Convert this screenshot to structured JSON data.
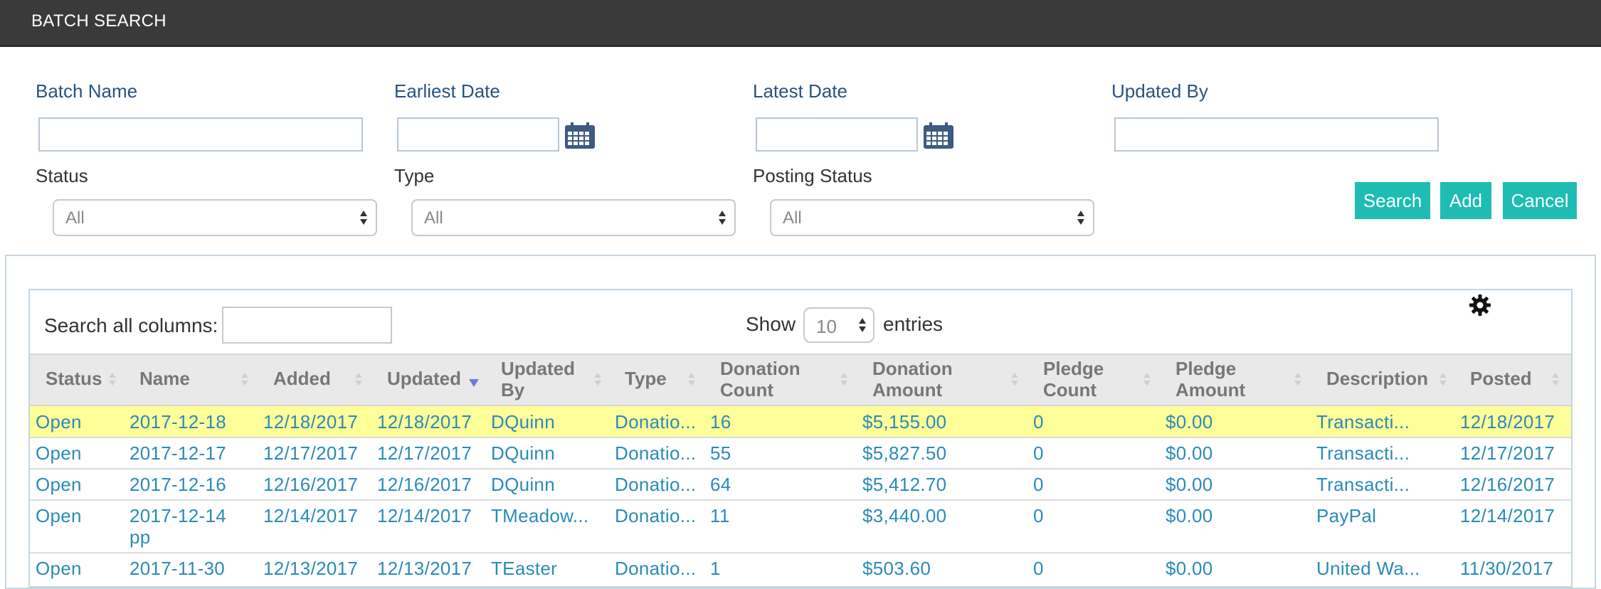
{
  "header": {
    "title": "BATCH SEARCH"
  },
  "filters": {
    "batch_name": {
      "label": "Batch Name",
      "value": ""
    },
    "earliest_date": {
      "label": "Earliest Date",
      "value": ""
    },
    "latest_date": {
      "label": "Latest Date",
      "value": ""
    },
    "updated_by": {
      "label": "Updated By",
      "value": ""
    },
    "status": {
      "label": "Status",
      "selected": "All"
    },
    "type": {
      "label": "Type",
      "selected": "All"
    },
    "posting_status": {
      "label": "Posting Status",
      "selected": "All"
    }
  },
  "actions": {
    "search": "Search",
    "add": "Add",
    "cancel": "Cancel"
  },
  "table_controls": {
    "search_label": "Search all columns:",
    "show_label": "Show",
    "page_length": "10",
    "entries_label": "entries"
  },
  "columns": {
    "status": "Status",
    "name": "Name",
    "added": "Added",
    "updated": "Updated",
    "updated_by_1": "Updated",
    "updated_by_2": "By",
    "type": "Type",
    "donation_count_1": "Donation",
    "donation_count_2": "Count",
    "donation_amount_1": "Donation",
    "donation_amount_2": "Amount",
    "pledge_count_1": "Pledge",
    "pledge_count_2": "Count",
    "pledge_amount_1": "Pledge",
    "pledge_amount_2": "Amount",
    "description": "Description",
    "posted": "Posted"
  },
  "rows": [
    {
      "status": "Open",
      "name": "2017-12-18",
      "name2": "",
      "added": "12/18/2017",
      "updated": "12/18/2017",
      "updated_by": "DQuinn",
      "type": "Donatio...",
      "donation_count": "16",
      "donation_amount": "$5,155.00",
      "pledge_count": "0",
      "pledge_amount": "$0.00",
      "description": "Transacti...",
      "posted": "12/18/2017"
    },
    {
      "status": "Open",
      "name": "2017-12-17",
      "name2": "",
      "added": "12/17/2017",
      "updated": "12/17/2017",
      "updated_by": "DQuinn",
      "type": "Donatio...",
      "donation_count": "55",
      "donation_amount": "$5,827.50",
      "pledge_count": "0",
      "pledge_amount": "$0.00",
      "description": "Transacti...",
      "posted": "12/17/2017"
    },
    {
      "status": "Open",
      "name": "2017-12-16",
      "name2": "",
      "added": "12/16/2017",
      "updated": "12/16/2017",
      "updated_by": "DQuinn",
      "type": "Donatio...",
      "donation_count": "64",
      "donation_amount": "$5,412.70",
      "pledge_count": "0",
      "pledge_amount": "$0.00",
      "description": "Transacti...",
      "posted": "12/16/2017"
    },
    {
      "status": "Open",
      "name": "2017-12-14",
      "name2": "pp",
      "added": "12/14/2017",
      "updated": "12/14/2017",
      "updated_by": "TMeadow...",
      "type": "Donatio...",
      "donation_count": "11",
      "donation_amount": "$3,440.00",
      "pledge_count": "0",
      "pledge_amount": "$0.00",
      "description": "PayPal",
      "posted": "12/14/2017"
    },
    {
      "status": "Open",
      "name": "2017-11-30",
      "name2": "",
      "added": "12/13/2017",
      "updated": "12/13/2017",
      "updated_by": "TEaster",
      "type": "Donatio...",
      "donation_count": "1",
      "donation_amount": "$503.60",
      "pledge_count": "0",
      "pledge_amount": "$0.00",
      "description": "United Wa...",
      "posted": "11/30/2017"
    }
  ],
  "colors": {
    "accent": "#1ebcb3",
    "header_bar": "#3a3a3a",
    "label_blue": "#2a5380",
    "link": "#2a8bb8",
    "highlight": "#ffff99"
  }
}
